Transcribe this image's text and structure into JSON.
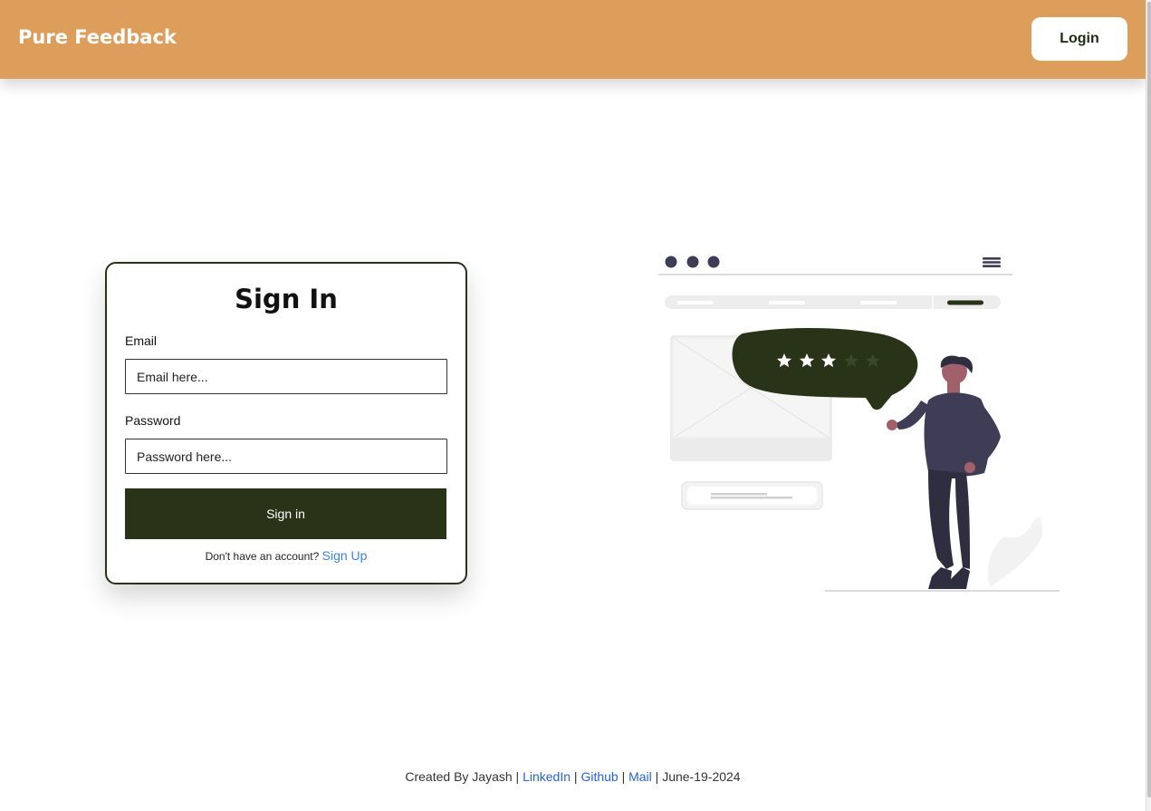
{
  "navbar": {
    "brand": "Pure Feedback",
    "login_label": "Login"
  },
  "signin": {
    "title": "Sign In",
    "email_label": "Email",
    "email_placeholder": "Email here...",
    "password_label": "Password",
    "password_placeholder": "Password here...",
    "submit_label": "Sign in",
    "signup_prompt": "Don't have an account?",
    "signup_link": "Sign Up"
  },
  "illustration": {
    "description_icon": "feedback-illustration",
    "rating_filled": 3,
    "rating_total": 5
  },
  "footer": {
    "created_by": "Created By Jayash |",
    "linkedin": "LinkedIn",
    "sep1": "|",
    "github": "Github",
    "sep2": "|",
    "mail": "Mail",
    "date_text": "| June-19-2024"
  },
  "colors": {
    "navbar": "#dc9e5a",
    "primary": "#283318",
    "link": "#3b82e6"
  }
}
